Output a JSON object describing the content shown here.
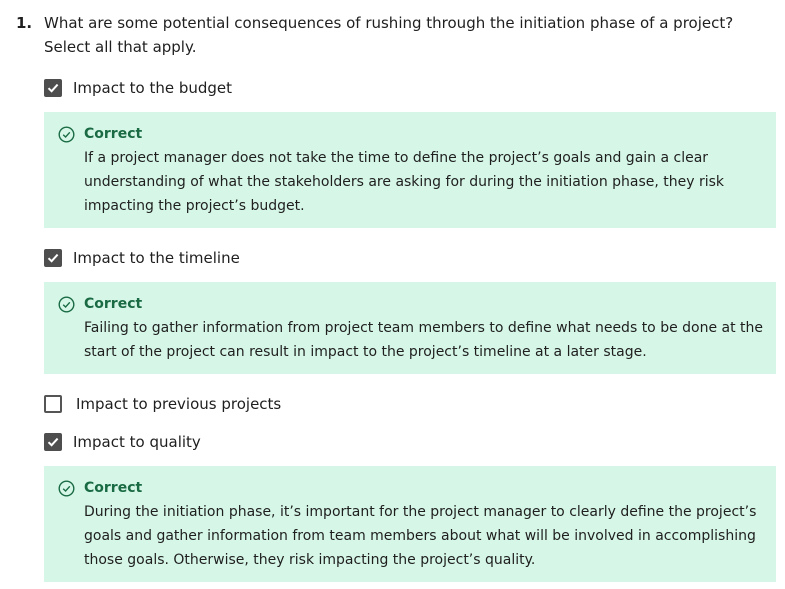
{
  "question": {
    "number": "1.",
    "text": "What are some potential consequences of rushing through the initiation phase of a project? Select all that apply."
  },
  "options": [
    {
      "label": "Impact to the budget",
      "checked": true,
      "feedback": {
        "status": "Correct",
        "text": "If a project manager does not take the time to define the project’s goals and gain a clear understanding of what the stakeholders are asking for during the initiation phase, they risk impacting the project’s budget."
      }
    },
    {
      "label": "Impact to the timeline",
      "checked": true,
      "feedback": {
        "status": "Correct",
        "text": "Failing to gather information from project team members to define what needs to be done at the start of the project can result in impact to the project’s timeline at a later stage."
      }
    },
    {
      "label": "Impact to previous projects",
      "checked": false
    },
    {
      "label": "Impact to quality",
      "checked": true,
      "feedback": {
        "status": "Correct",
        "text": "During the initiation phase, it’s important for the project manager to clearly define the project’s goals and gather information from team members about what will be involved in accomplishing those goals. Otherwise, they risk impacting the project’s quality."
      }
    }
  ],
  "icons": {
    "checkbox": "check-icon",
    "feedback": "check-circle-icon"
  },
  "colors": {
    "feedback_bg": "#d6f7e8",
    "correct_text": "#1a6b43",
    "checkbox_fill": "#4e4e4e"
  }
}
